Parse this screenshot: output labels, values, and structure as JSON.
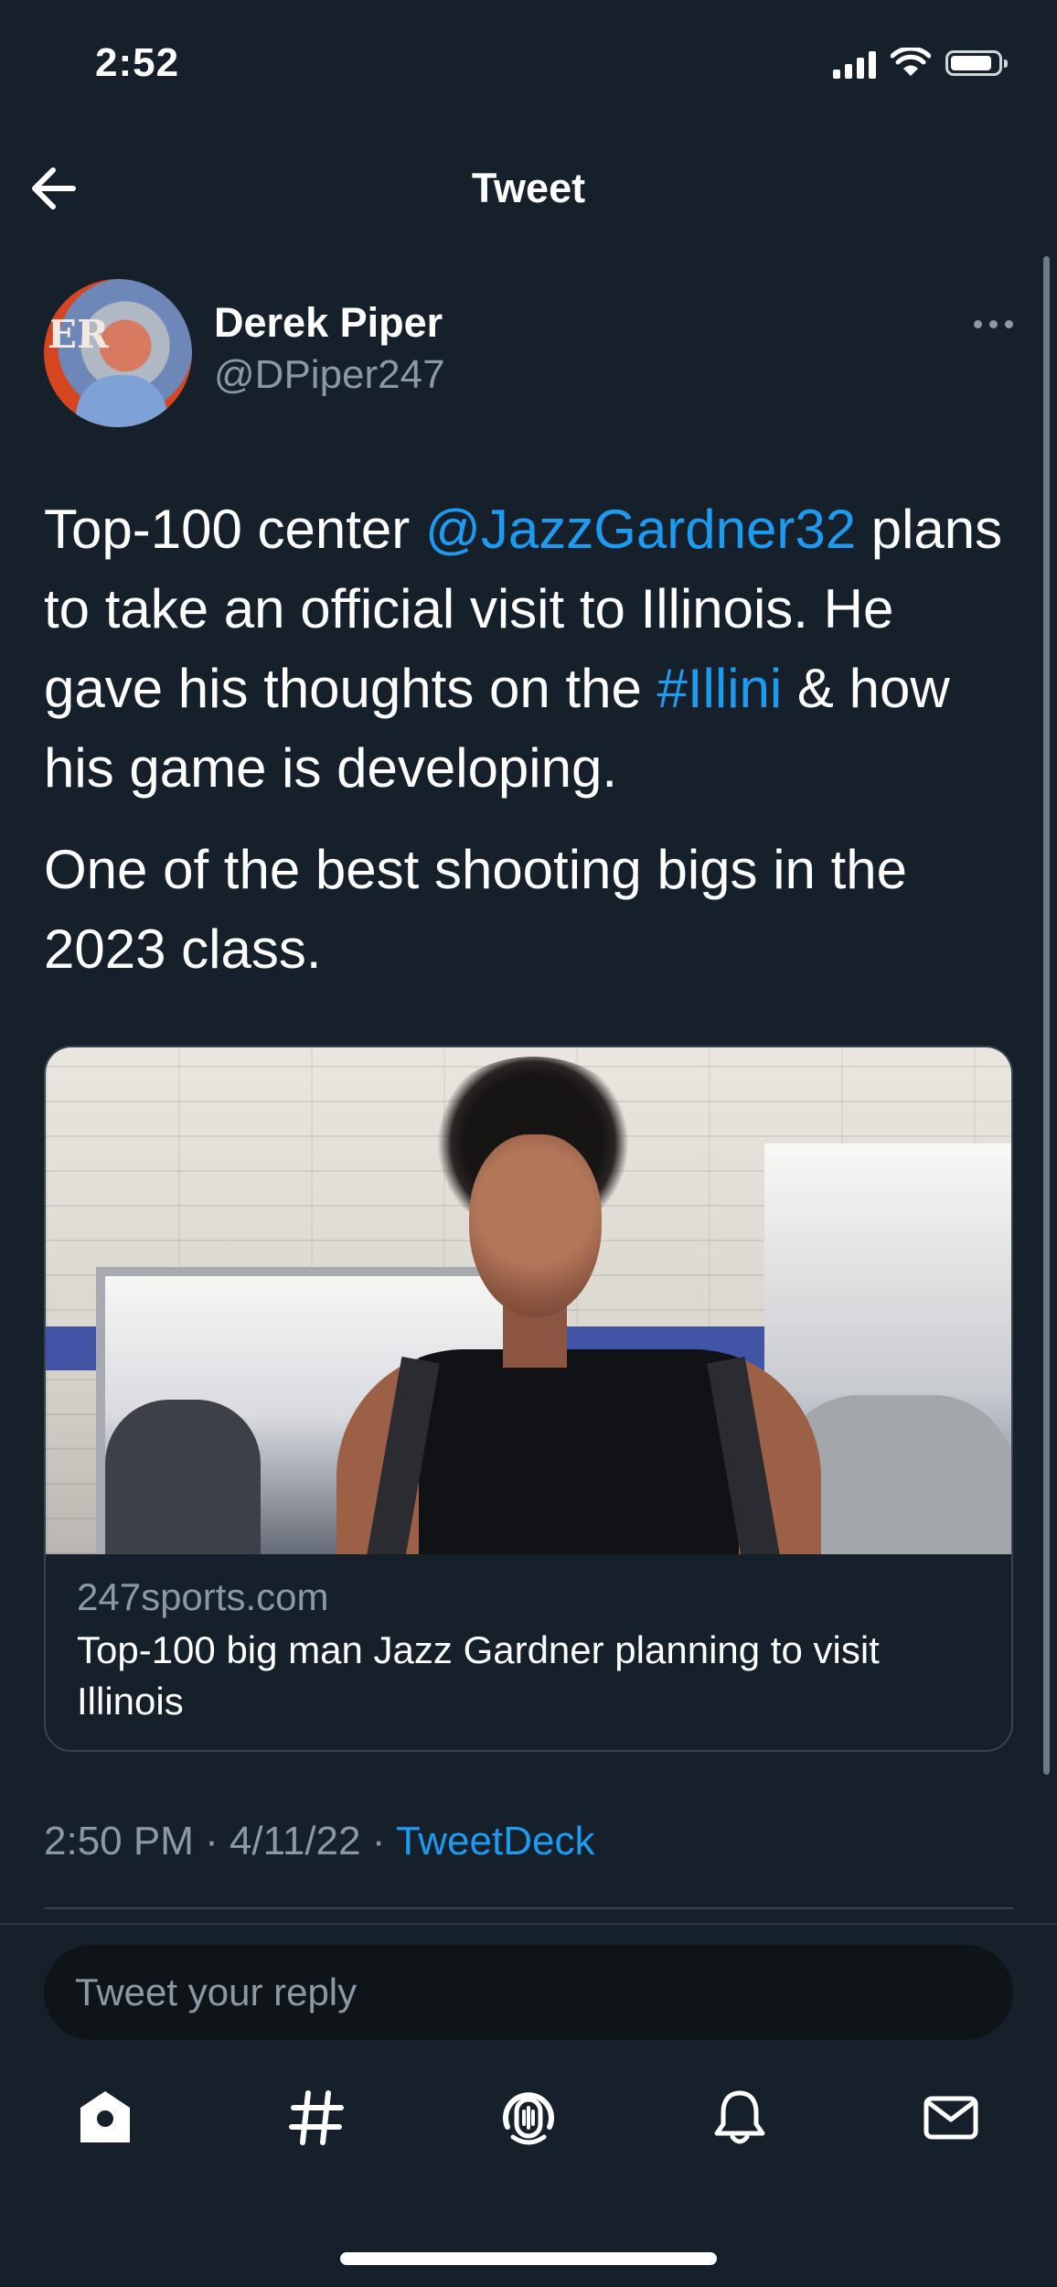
{
  "status_bar": {
    "time": "2:52",
    "icons": [
      "cellular-signal-icon",
      "wifi-icon",
      "battery-icon"
    ]
  },
  "header": {
    "title": "Tweet",
    "back_icon": "back-arrow-icon"
  },
  "tweet": {
    "author": {
      "display_name": "Derek Piper",
      "handle": "@DPiper247",
      "avatar_icon": "avatar-photo"
    },
    "text": {
      "line1_prefix": "Top-100 center ",
      "mention": "@JazzGardner32",
      "line2": " plans to take an official visit to Illinois. He gave his thoughts on the ",
      "hashtag": "#Illini",
      "line2_suffix": " & how his game is developing.",
      "paragraph2": "One of the best shooting bigs in the 2023 class."
    },
    "card": {
      "domain": "247sports.com",
      "title": "Top-100 big man Jazz Gardner planning to visit Illinois",
      "image_description_icon": "link-preview-photo"
    },
    "metadata": {
      "time_date": "2:50 PM · 4/11/22 · ",
      "client": "TweetDeck"
    }
  },
  "reply": {
    "placeholder": "Tweet your reply"
  },
  "tab_bar": {
    "items": [
      "home-icon",
      "explore-hashtag-icon",
      "spaces-icon",
      "notifications-icon",
      "messages-icon"
    ]
  },
  "colors": {
    "background": "#15202b",
    "accent": "#1d9bf0",
    "secondary_text": "#8b98a5"
  }
}
